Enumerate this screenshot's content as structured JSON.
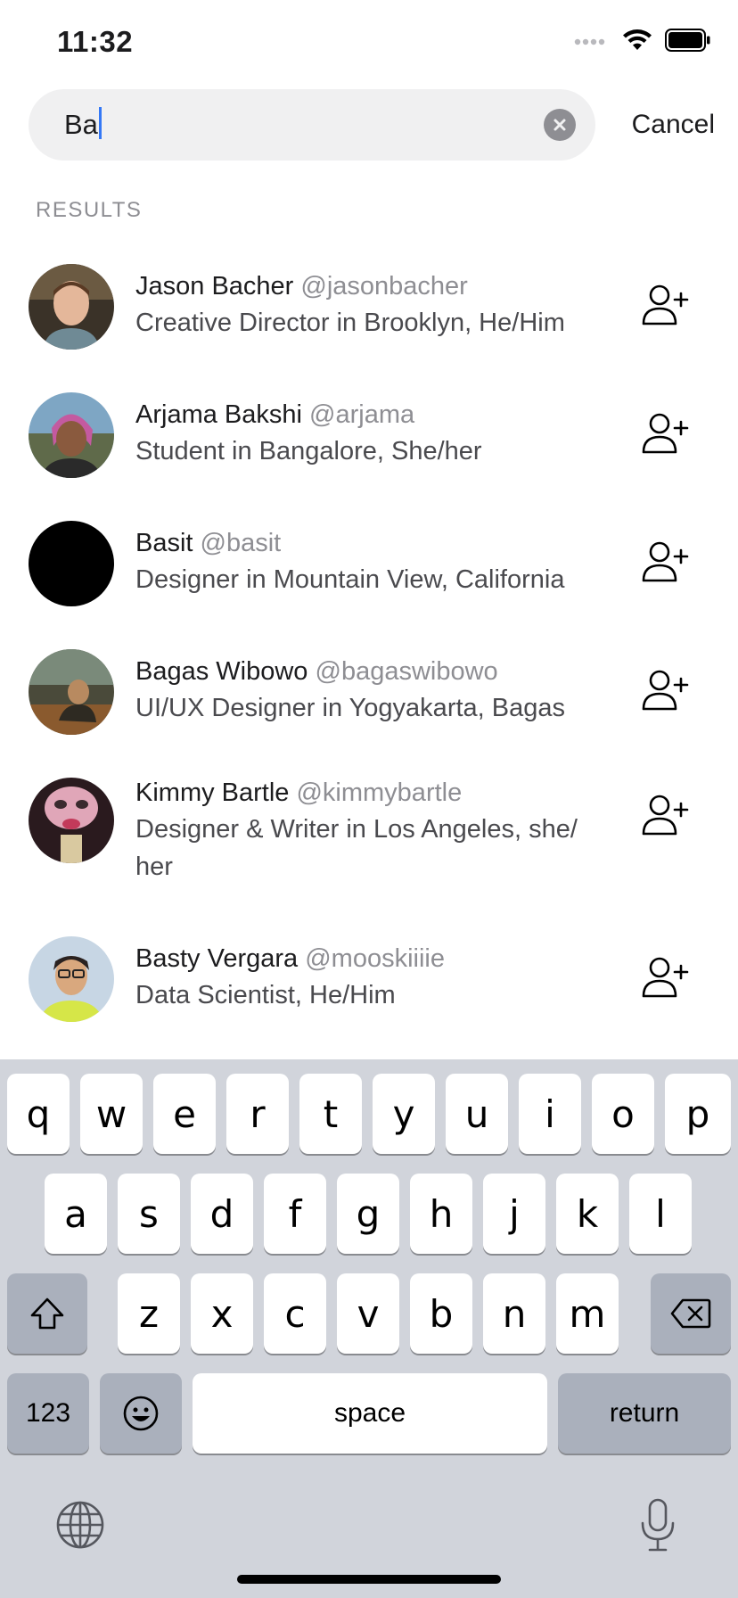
{
  "status_bar": {
    "time": "11:32"
  },
  "search": {
    "value": "Ba",
    "cancel_label": "Cancel"
  },
  "section": {
    "header": "RESULTS"
  },
  "results": [
    {
      "name": "Jason Bacher",
      "handle": "@jasonbacher",
      "bio": "Creative Director in Brooklyn, He/Him",
      "avatar_color": "#5a4a3a"
    },
    {
      "name": "Arjama Bakshi",
      "handle": "@arjama",
      "bio": "Student in Bangalore, She/her",
      "avatar_color": "#8a6a72"
    },
    {
      "name": "Basit",
      "handle": "@basit",
      "bio": "Designer in Mountain View, California",
      "avatar_color": "#000000"
    },
    {
      "name": "Bagas Wibowo",
      "handle": "@bagaswibowo",
      "bio": "UI/UX Designer in Yogyakarta, Bagas",
      "avatar_color": "#3d3a2e"
    },
    {
      "name": "Kimmy Bartle",
      "handle": "@kimmybartle",
      "bio": "Designer & Writer in Los Angeles, she/ her",
      "avatar_color": "#b08a96"
    },
    {
      "name": "Basty Vergara",
      "handle": "@mooskiiiie",
      "bio": "Data Scientist, He/Him",
      "avatar_color": "#c9d8e6"
    }
  ],
  "keyboard": {
    "row1": [
      "q",
      "w",
      "e",
      "r",
      "t",
      "y",
      "u",
      "i",
      "o",
      "p"
    ],
    "row2": [
      "a",
      "s",
      "d",
      "f",
      "g",
      "h",
      "j",
      "k",
      "l"
    ],
    "row3": [
      "z",
      "x",
      "c",
      "v",
      "b",
      "n",
      "m"
    ],
    "numbers_label": "123",
    "space_label": "space",
    "return_label": "return"
  },
  "icons": {
    "signal": "cellular-signal-icon",
    "wifi": "wifi-icon",
    "battery": "battery-icon",
    "clear": "clear-icon",
    "add_user": "add-user-icon",
    "shift": "shift-icon",
    "backspace": "backspace-icon",
    "emoji": "emoji-icon",
    "globe": "globe-icon",
    "mic": "microphone-icon"
  }
}
